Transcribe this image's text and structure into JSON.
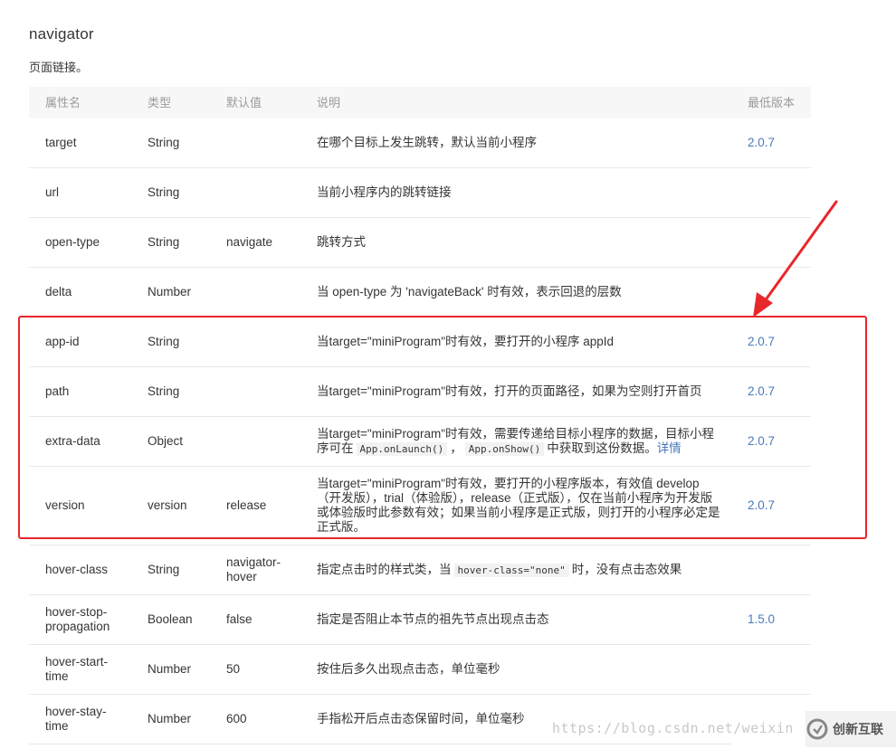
{
  "page": {
    "title": "navigator",
    "description": "页面链接。"
  },
  "table": {
    "headers": [
      "属性名",
      "类型",
      "默认值",
      "说明",
      "最低版本"
    ],
    "rows": [
      {
        "name": "target",
        "type": "String",
        "default": "",
        "desc": "在哪个目标上发生跳转，默认当前小程序",
        "version": "2.0.7"
      },
      {
        "name": "url",
        "type": "String",
        "default": "",
        "desc": "当前小程序内的跳转链接",
        "version": ""
      },
      {
        "name": "open-type",
        "type": "String",
        "default": "navigate",
        "desc": "跳转方式",
        "version": ""
      },
      {
        "name": "delta",
        "type": "Number",
        "default": "",
        "desc": "当 open-type 为 'navigateBack' 时有效，表示回退的层数",
        "version": ""
      },
      {
        "name": "app-id",
        "type": "String",
        "default": "",
        "desc": "当target=\"miniProgram\"时有效，要打开的小程序 appId",
        "version": "2.0.7"
      },
      {
        "name": "path",
        "type": "String",
        "default": "",
        "desc": "当target=\"miniProgram\"时有效，打开的页面路径，如果为空则打开首页",
        "version": "2.0.7"
      },
      {
        "name": "extra-data",
        "type": "Object",
        "default": "",
        "desc_a": "当target=\"miniProgram\"时有效，需要传递给目标小程序的数据，目标小程序可在",
        "code1": "App.onLaunch()",
        "sep": "，",
        "code2": "App.onShow()",
        "desc_b": "中获取到这份数据。",
        "link": "详情",
        "version": "2.0.7"
      },
      {
        "name": "version",
        "type": "version",
        "default": "release",
        "desc": "当target=\"miniProgram\"时有效，要打开的小程序版本，有效值 develop（开发版），trial（体验版），release（正式版），仅在当前小程序为开发版或体验版时此参数有效；如果当前小程序是正式版，则打开的小程序必定是正式版。",
        "version": "2.0.7"
      },
      {
        "name": "hover-class",
        "type": "String",
        "default": "navigator-hover",
        "desc_a": "指定点击时的样式类，当",
        "code1": "hover-class=\"none\"",
        "desc_b": "时，没有点击态效果",
        "version": ""
      },
      {
        "name": "hover-stop-propagation",
        "type": "Boolean",
        "default": "false",
        "desc": "指定是否阻止本节点的祖先节点出现点击态",
        "version": "1.5.0"
      },
      {
        "name": "hover-start-time",
        "type": "Number",
        "default": "50",
        "desc": "按住后多久出现点击态，单位毫秒",
        "version": ""
      },
      {
        "name": "hover-stay-time",
        "type": "Number",
        "default": "600",
        "desc": "手指松开后点击态保留时间，单位毫秒",
        "version": ""
      }
    ]
  },
  "annotation": {
    "box_color": "#e8272b",
    "arrow_color": "#e8272b"
  },
  "watermark": {
    "url_text": "https://blog.csdn.net/weixin",
    "logo_text": "创新互联"
  },
  "colors": {
    "link": "#4a79bd",
    "header_bg": "#f7f7f7",
    "header_text": "#9b9b9b"
  }
}
